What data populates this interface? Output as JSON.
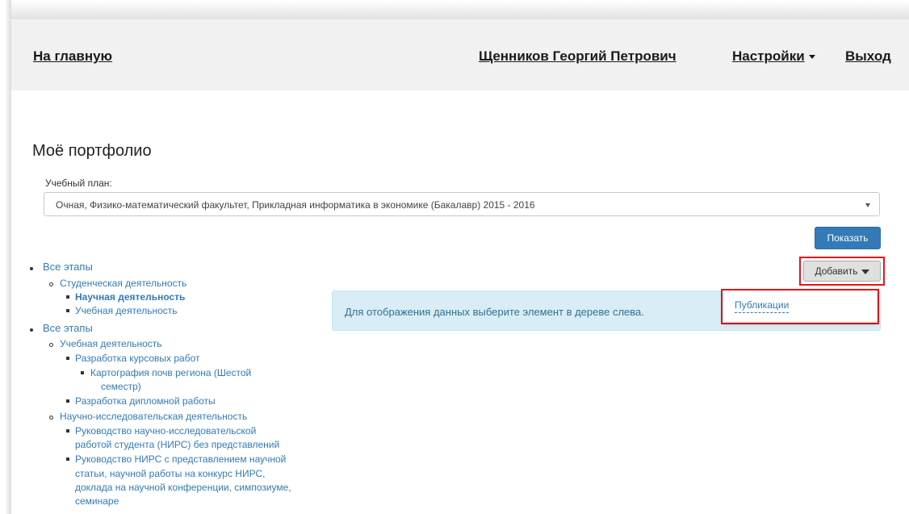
{
  "nav": {
    "home": "На главную",
    "user": "Щенников Георгий Петрович",
    "settings": "Настройки",
    "logout": "Выход"
  },
  "page": {
    "title": "Моё портфолио",
    "plan_label": "Учебный план:",
    "plan_value": "Очная, Физико-математический факультет, Прикладная информатика в экономике (Бакалавр) 2015 - 2016",
    "show_button": "Показать",
    "add_button": "Добавить",
    "dropdown_items": [
      "Публикации"
    ],
    "info_message": "Для отображения данных выберите элемент в дереве слева."
  },
  "tree": {
    "group1": {
      "root": "Все этапы",
      "child": "Студенческая деятельность",
      "leaves": [
        "Научная деятельность",
        "Учебная деятельность"
      ]
    },
    "group2": {
      "root": "Все этапы",
      "child1": "Учебная деятельность",
      "child1_items": {
        "coursework": "Разработка курсовых работ",
        "coursework_sub_line1": "Картография почв региона (Шестой",
        "coursework_sub_line2": "семестр)",
        "diploma": "Разработка дипломной работы"
      },
      "child2": "Научно-исследовательская деятельность",
      "child2_items": {
        "nirs1_line1": "Руководство научно-исследовательской",
        "nirs1_line2": "работой студента (НИРС) без представлений",
        "nirs2_line1": "Руководство НИРС с представлением научной",
        "nirs2_line2": "статьи, научной работы на конкурс НИРС,",
        "nirs2_line3": "доклада на научной конференции, симпозиуме,",
        "nirs2_line4": "семинаре"
      }
    }
  }
}
